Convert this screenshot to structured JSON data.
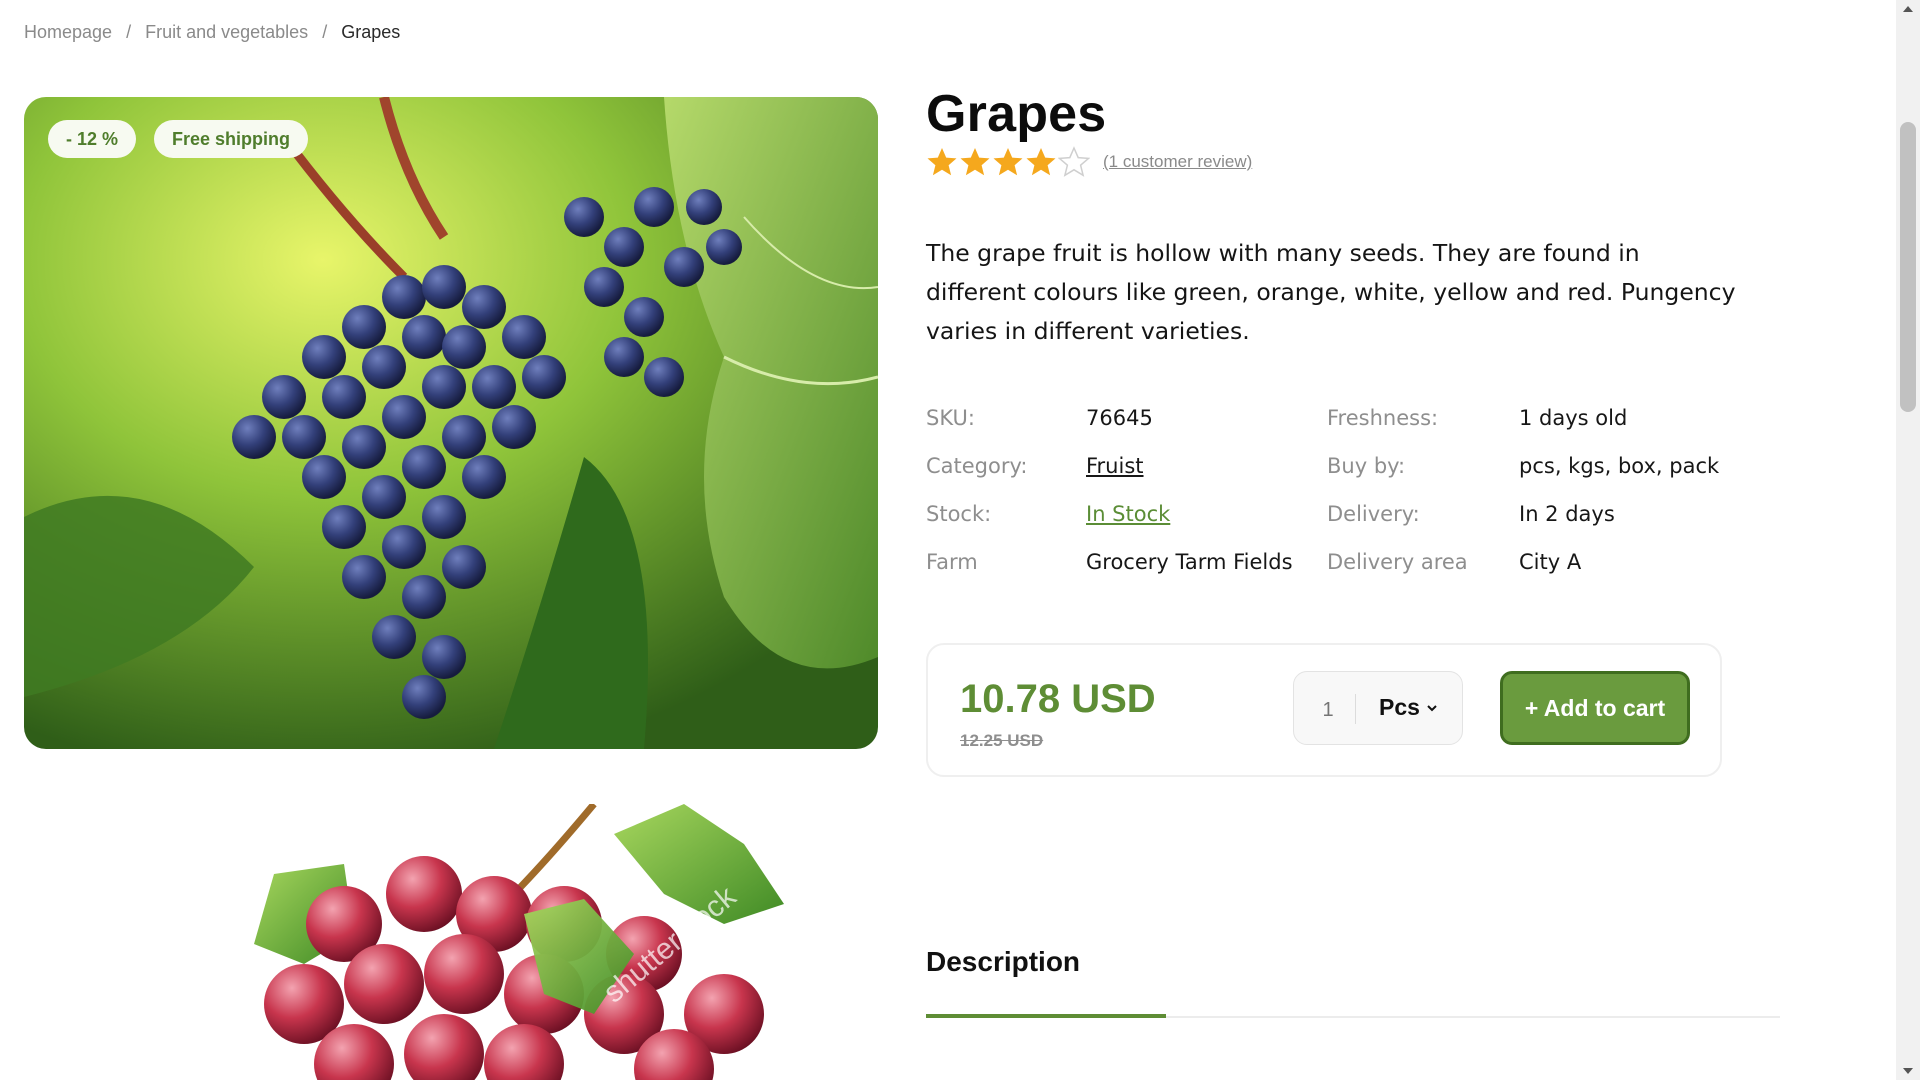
{
  "breadcrumb": {
    "items": [
      "Homepage",
      "Fruit and vegetables",
      "Grapes"
    ],
    "separator": "/"
  },
  "gallery": {
    "badges": {
      "discount": "- 12 %",
      "shipping": "Free shipping"
    },
    "watermark": "shutterstock"
  },
  "product": {
    "title": "Grapes",
    "rating": {
      "value": 4,
      "max": 5,
      "review_link": "(1 customer review)"
    },
    "description": "The grape fruit is hollow with many seeds. They are found in different colours like green, orange, white, yellow and red. Pungency varies in different varieties."
  },
  "specs": {
    "sku": {
      "label": "SKU:",
      "value": "76645"
    },
    "freshness": {
      "label": "Freshness:",
      "value": "1 days old"
    },
    "category": {
      "label": "Category:",
      "value": "Fruist"
    },
    "buy_by": {
      "label": "Buy by:",
      "value": "pcs, kgs, box, pack"
    },
    "stock": {
      "label": "Stock:",
      "value": "In Stock"
    },
    "delivery": {
      "label": "Delivery:",
      "value": "In 2 days"
    },
    "farm": {
      "label": "Farm",
      "value": "Grocery Tarm Fields"
    },
    "delivery_area": {
      "label": "Delivery area",
      "value": "City A"
    }
  },
  "purchase": {
    "price": "10.78 USD",
    "old_price": "12.25 USD",
    "quantity_placeholder": "1",
    "unit": "Pcs",
    "add_to_cart": "+ Add to cart"
  },
  "tabs": {
    "active": "Description"
  },
  "colors": {
    "accent_green": "#5e8d35",
    "button_green": "#6a9b3e",
    "star_gold": "#f5a81d"
  }
}
